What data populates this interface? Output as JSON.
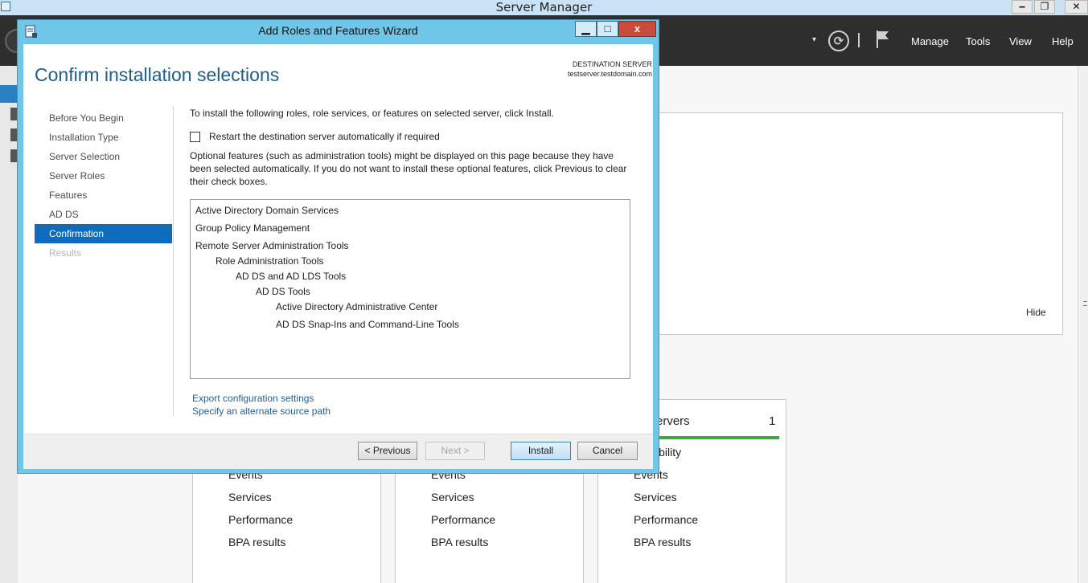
{
  "server_manager": {
    "title": "Server Manager",
    "menu": {
      "manage": "Manage",
      "tools": "Tools",
      "view": "View",
      "help": "Help"
    },
    "dropdown_glyph": "▾",
    "refresh_glyph": "⟳",
    "welcome_hide": "Hide",
    "tile_header": "ervers",
    "tile_count": "1",
    "tile_manageability": "ageability",
    "tile_items": {
      "events": "Events",
      "services": "Services",
      "performance": "Performance",
      "bpa": "BPA results"
    }
  },
  "wizard": {
    "title": "Add Roles and Features Wizard",
    "window_buttons": {
      "minimize": "▁",
      "maximize": "□",
      "close": "x"
    },
    "heading": "Confirm installation selections",
    "destination_label": "DESTINATION SERVER",
    "destination_server": "testserver.testdomain.com",
    "steps": [
      {
        "label": "Before You Begin"
      },
      {
        "label": "Installation Type"
      },
      {
        "label": "Server Selection"
      },
      {
        "label": "Server Roles"
      },
      {
        "label": "Features"
      },
      {
        "label": "AD DS"
      },
      {
        "label": "Confirmation"
      },
      {
        "label": "Results"
      }
    ],
    "intro": "To install the following roles, role services, or features on selected server, click Install.",
    "restart_label": "Restart the destination server automatically if required",
    "restart_checked": false,
    "optional_text": "Optional features (such as administration tools) might be displayed on this page because they have been selected automatically. If you do not want to install these optional features, click Previous to clear their check boxes.",
    "selections": [
      {
        "label": "Active Directory Domain Services",
        "level": 0
      },
      {
        "label": "Group Policy Management",
        "level": 0
      },
      {
        "label": "Remote Server Administration Tools",
        "level": 0
      },
      {
        "label": "Role Administration Tools",
        "level": 1
      },
      {
        "label": "AD DS and AD LDS Tools",
        "level": 2
      },
      {
        "label": "AD DS Tools",
        "level": 3
      },
      {
        "label": "Active Directory Administrative Center",
        "level": 4
      },
      {
        "label": "AD DS Snap-Ins and Command-Line Tools",
        "level": 4
      }
    ],
    "links": {
      "export": "Export configuration settings",
      "alternate_source": "Specify an alternate source path"
    },
    "buttons": {
      "previous": "< Previous",
      "next": "Next >",
      "install": "Install",
      "cancel": "Cancel"
    }
  }
}
